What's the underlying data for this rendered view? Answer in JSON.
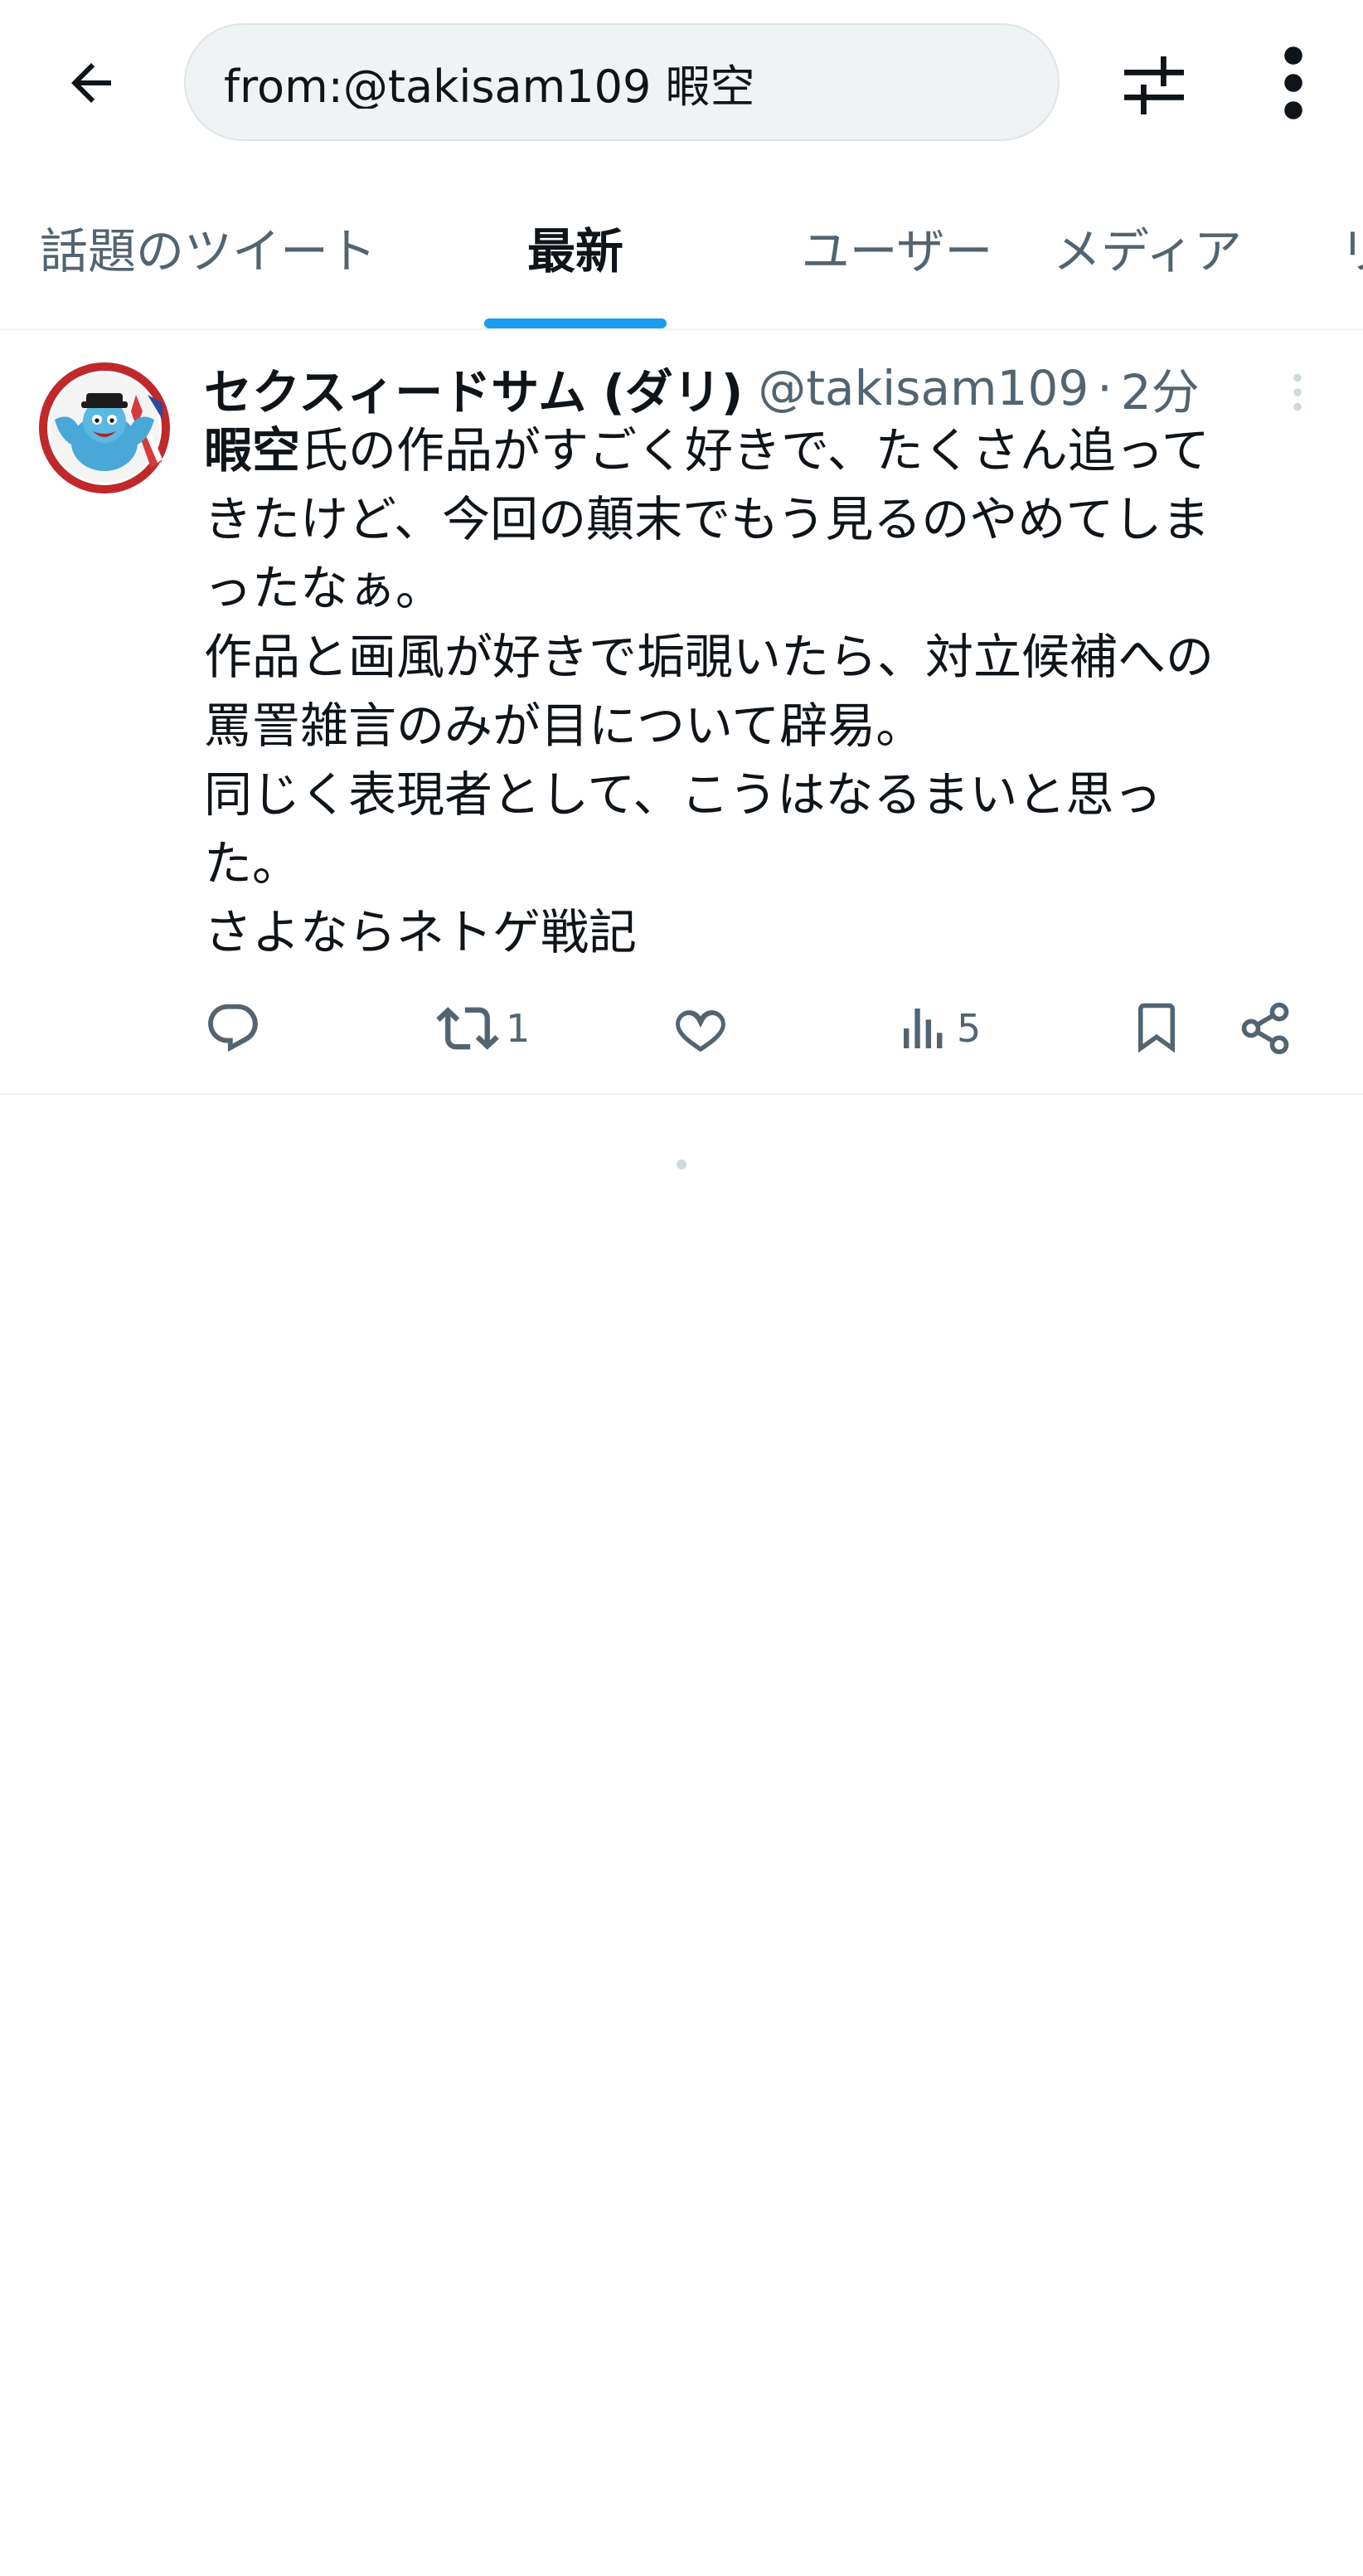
{
  "search": {
    "query": "from:@takisam109 暇空"
  },
  "tabs": [
    {
      "label": "話題のツイート"
    },
    {
      "label": "最新"
    },
    {
      "label": "ユーザー"
    },
    {
      "label": "メディア"
    },
    {
      "label": "リ"
    }
  ],
  "tweet": {
    "display_name": "セクスィードサム (ダリ)",
    "handle": "@takisam109",
    "separator": "·",
    "time": "2分",
    "lines": {
      "l1_bold": "暇空",
      "l1_rest": "氏の作品がすごく好きで、たくさん追って",
      "l2": "きたけど、今回の顛末でもう見るのやめてしま",
      "l3": "ったなぁ。",
      "l4": "作品と画風が好きで垢覗いたら、対立候補への",
      "l5": "罵詈雑言のみが目について辟易。",
      "l6": "同じく表現者として、こうはなるまいと思っ",
      "l7": "た。",
      "l8": "さよならネトゲ戦記"
    },
    "retweet_count": "1",
    "views_count": "5"
  },
  "colors": {
    "accent": "#1d9bf0",
    "text_primary": "#0f1419",
    "text_secondary": "#536471",
    "search_bg": "#eff3f4"
  },
  "icons": {
    "back": "arrow-left-icon",
    "filter": "sliders-icon",
    "more": "more-vertical-icon",
    "reply": "reply-icon",
    "retweet": "retweet-icon",
    "like": "heart-icon",
    "views": "bar-chart-icon",
    "bookmark": "bookmark-icon",
    "share": "share-icon"
  }
}
